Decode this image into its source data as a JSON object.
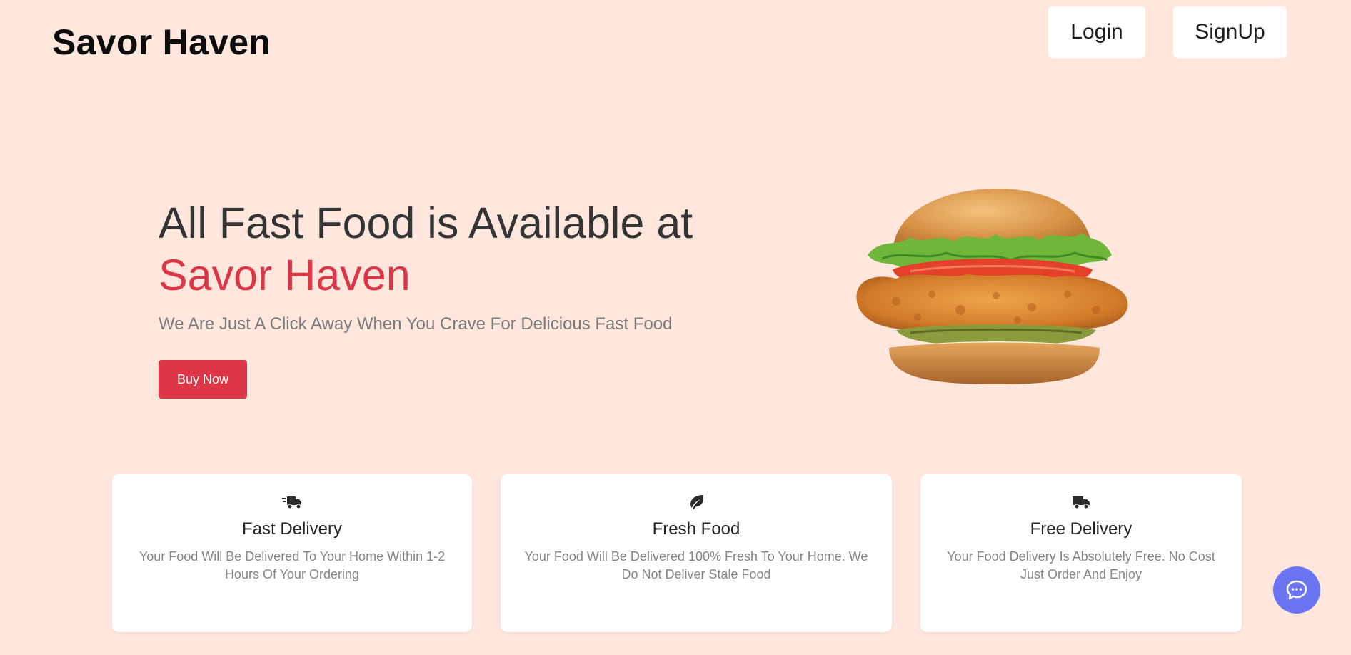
{
  "header": {
    "brand": "Savor Haven",
    "login_label": "Login",
    "signup_label": "SignUp"
  },
  "hero": {
    "title_line1": "All Fast Food is Available at",
    "title_accent": "Savor Haven",
    "subtitle": "We Are Just A Click Away When You Crave For Delicious Fast Food",
    "buy_label": "Buy Now",
    "image_icon": "burger-image"
  },
  "features": [
    {
      "icon": "shipping-fast-icon",
      "title": "Fast Delivery",
      "text": "Your Food Will Be Delivered To Your Home Within 1-2 Hours Of Your Ordering"
    },
    {
      "icon": "leaf-icon",
      "title": "Fresh Food",
      "text": "Your Food Will Be Delivered 100% Fresh To Your Home. We Do Not Deliver Stale Food"
    },
    {
      "icon": "truck-icon",
      "title": "Free Delivery",
      "text": "Your Food Delivery Is Absolutely Free. No Cost Just Order And Enjoy"
    }
  ],
  "chat": {
    "icon": "chat-bubble-icon"
  },
  "colors": {
    "background": "#ffe7de",
    "accent": "#dc3545",
    "chat": "#6b75f2"
  }
}
